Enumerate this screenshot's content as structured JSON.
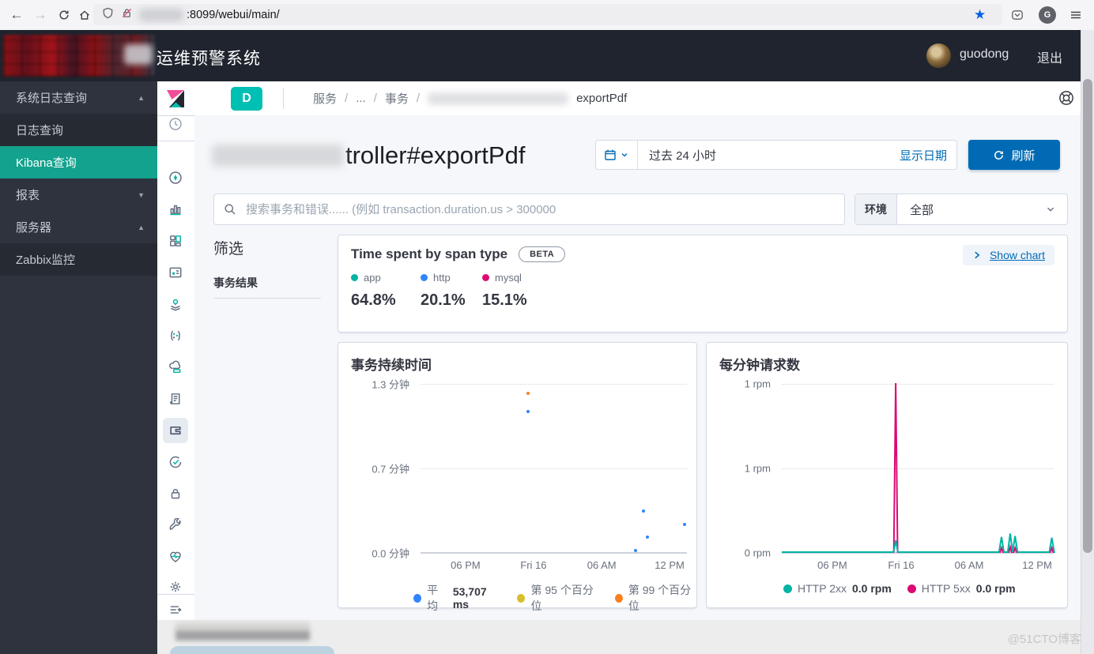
{
  "browser": {
    "url": ":8099/webui/main/"
  },
  "header": {
    "title": "运维预警系统",
    "username": "guodong",
    "logout": "退出"
  },
  "sidebar": {
    "items": [
      {
        "label": "系统日志查询",
        "chevron": "▲",
        "type": "group"
      },
      {
        "label": "日志查询",
        "chevron": "",
        "type": "sub"
      },
      {
        "label": "Kibana查询",
        "chevron": "",
        "type": "sub-selected"
      },
      {
        "label": "报表",
        "chevron": "▼",
        "type": "group"
      },
      {
        "label": "服务器",
        "chevron": "▲",
        "type": "group"
      },
      {
        "label": "Zabbix监控",
        "chevron": "",
        "type": "sub"
      }
    ]
  },
  "kibana": {
    "breadcrumb": {
      "badge": "D",
      "crumb1": "服务",
      "crumb2": "...",
      "crumb3": "事务",
      "sep": "/",
      "current": "exportPdf"
    },
    "page_title_visible": "troller#exportPdf",
    "time_picker": {
      "range": "过去 24 小时",
      "show_dates": "显示日期",
      "refresh": "刷新"
    },
    "search_placeholder": "搜索事务和错误...... (例如 transaction.duration.us > 300000",
    "environment": {
      "label": "环境",
      "value": "全部"
    },
    "filters": {
      "title": "筛选",
      "item": "事务结果"
    },
    "span_panel": {
      "title": "Time spent by span type",
      "beta": "BETA",
      "show_chart": "Show chart",
      "items": [
        {
          "name": "app",
          "pct": "64.8%",
          "color": "#00b3a4"
        },
        {
          "name": "http",
          "pct": "20.1%",
          "color": "#3185fc"
        },
        {
          "name": "mysql",
          "pct": "15.1%",
          "color": "#dd0a73"
        }
      ]
    }
  },
  "chart_data": [
    {
      "type": "scatter",
      "title": "事务持续时间",
      "y_ticks": [
        "1.3 分钟",
        "0.7 分钟",
        "0.0 分钟"
      ],
      "y_range_min": [
        0,
        1.3
      ],
      "grid": "horizontal-dotted",
      "legend_position": "bottom",
      "x_ticks": [
        {
          "label": "06 PM",
          "x_pct": 16.9
        },
        {
          "label": "Fri 16",
          "x_pct": 42.4
        },
        {
          "label": "06 AM",
          "x_pct": 68.0
        },
        {
          "label": "12 PM",
          "x_pct": 93.5
        }
      ],
      "series": [
        {
          "name": "平均",
          "color": "#3185fc",
          "points": [
            {
              "x_pct": 40.5,
              "y_pct": 16.5,
              "minutes": 1.09
            },
            {
              "x_pct": 83.7,
              "y_pct": 75.0,
              "minutes": 0.33
            },
            {
              "x_pct": 99.0,
              "y_pct": 83.0,
              "minutes": 0.22
            },
            {
              "x_pct": 85.2,
              "y_pct": 90.5,
              "minutes": 0.12
            },
            {
              "x_pct": 80.8,
              "y_pct": 98.5,
              "minutes": 0.02
            }
          ]
        },
        {
          "name": "第 95 个百分位",
          "color": "#d6bf2b",
          "points": []
        },
        {
          "name": "第 99 个百分位",
          "color": "#fa8020",
          "points": [
            {
              "x_pct": 40.5,
              "y_pct": 5.5,
              "minutes": 1.23
            }
          ]
        }
      ],
      "legend": [
        {
          "name": "平均",
          "value": "53,707 ms",
          "color": "#3185fc"
        },
        {
          "name": "第 95 个百分位",
          "value": "",
          "color": "#d6bf2b"
        },
        {
          "name": "第 99 个百分位",
          "value": "",
          "color": "#fa8020"
        }
      ]
    },
    {
      "type": "line",
      "title": "每分钟请求数",
      "y_ticks": [
        "1 rpm",
        "1 rpm",
        "0 rpm"
      ],
      "grid": "horizontal-dotted",
      "legend_position": "bottom",
      "x_ticks": [
        {
          "label": "06 PM",
          "x_pct": 18.6
        },
        {
          "label": "Fri 16",
          "x_pct": 43.9
        },
        {
          "label": "06 AM",
          "x_pct": 68.9
        },
        {
          "label": "12 PM",
          "x_pct": 93.9
        }
      ],
      "series": [
        {
          "name": "HTTP 5xx",
          "color": "#dd0a73",
          "spikes_x_h_w_pct": [
            [
              41.9,
              100,
              0.7
            ],
            [
              80.8,
              2.5,
              0.5
            ],
            [
              84.0,
              3,
              0.5
            ],
            [
              85.8,
              2.5,
              0.5
            ],
            [
              99.3,
              2.5,
              0.5
            ]
          ]
        },
        {
          "name": "HTTP 2xx",
          "color": "#00b3a4",
          "spikes_x_h_w_pct": [
            [
              41.9,
              7,
              0.8
            ],
            [
              80.8,
              9,
              0.9
            ],
            [
              84.0,
              11,
              0.9
            ],
            [
              85.8,
              9.5,
              0.9
            ],
            [
              99.3,
              8.5,
              0.9
            ]
          ]
        }
      ],
      "legend": [
        {
          "name": "HTTP 2xx",
          "value": "0.0 rpm",
          "color": "#00b3a4"
        },
        {
          "name": "HTTP 5xx",
          "value": "0.0 rpm",
          "color": "#dd0a73"
        }
      ]
    }
  ],
  "footer": {
    "watermark": "@51CTO博客"
  },
  "colors": {
    "primary_blue": "#006bb4",
    "badge_teal": "#00bfb3",
    "menu_selected_teal": "#13a28e",
    "header_dark": "#1f242e"
  }
}
